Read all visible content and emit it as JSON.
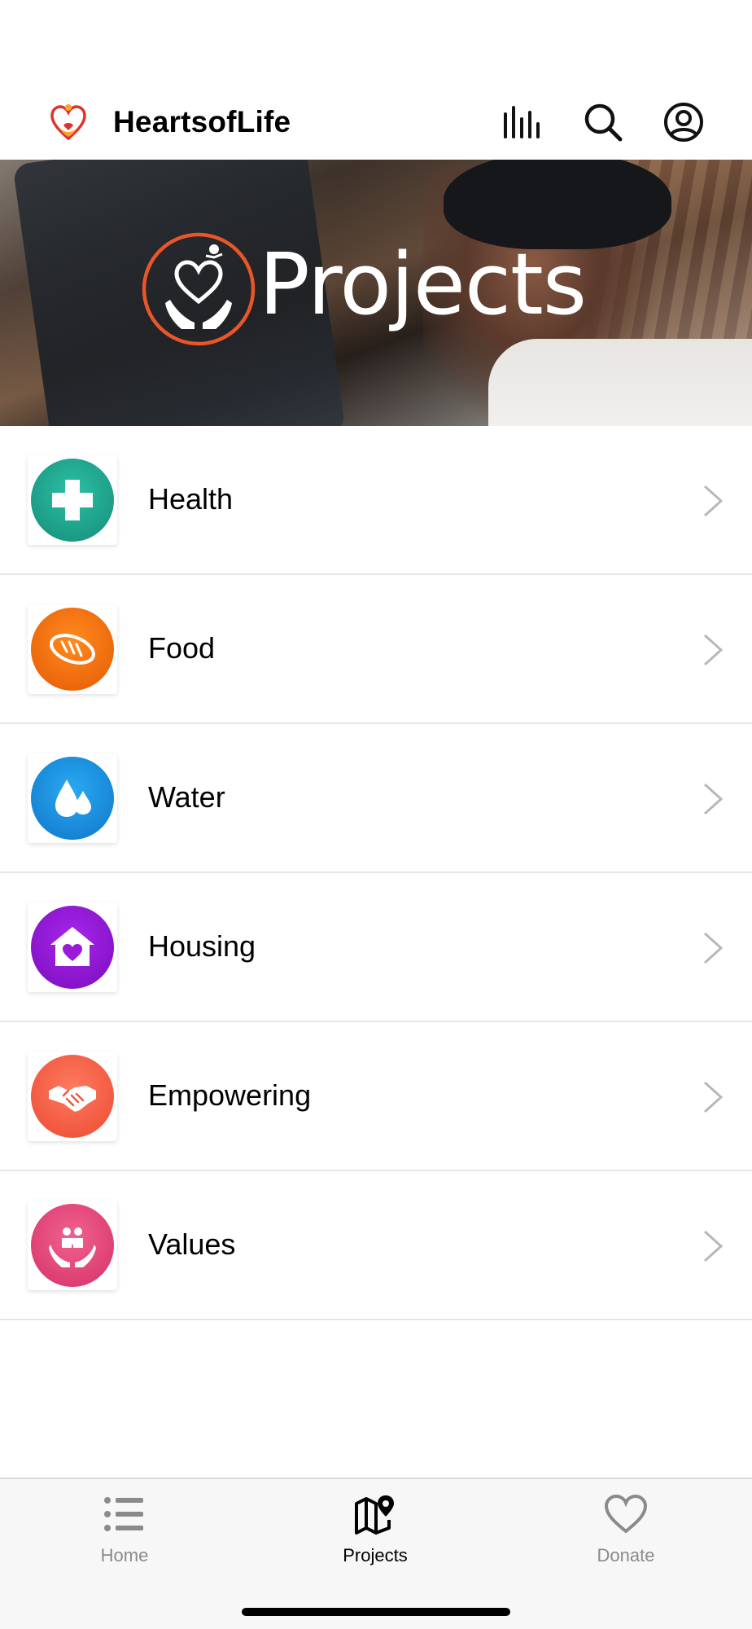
{
  "header": {
    "title": "HeartsofLife",
    "logo": "hearts-of-life-logo",
    "icons": [
      "bar-chart-icon",
      "search-icon",
      "account-icon"
    ]
  },
  "banner": {
    "title": "Projects",
    "logo": "heart-hands-logo"
  },
  "projects": [
    {
      "label": "Health",
      "icon": "medical-cross-icon",
      "color": "#1fa08a"
    },
    {
      "label": "Food",
      "icon": "bread-icon",
      "color": "#f26a0a"
    },
    {
      "label": "Water",
      "icon": "water-drops-icon",
      "color": "#1a8fe0"
    },
    {
      "label": "Housing",
      "icon": "house-heart-icon",
      "color": "#8e14d4"
    },
    {
      "label": "Empowering",
      "icon": "handshake-icon",
      "color": "#f2604a"
    },
    {
      "label": "Values",
      "icon": "family-hands-icon",
      "color": "#e4457a"
    }
  ],
  "tabbar": {
    "tabs": [
      {
        "label": "Home",
        "icon": "list-icon",
        "active": false
      },
      {
        "label": "Projects",
        "icon": "map-pin-icon",
        "active": true
      },
      {
        "label": "Donate",
        "icon": "heart-icon",
        "active": false
      }
    ],
    "active_color": "#000000",
    "inactive_color": "#8a8a8a"
  }
}
